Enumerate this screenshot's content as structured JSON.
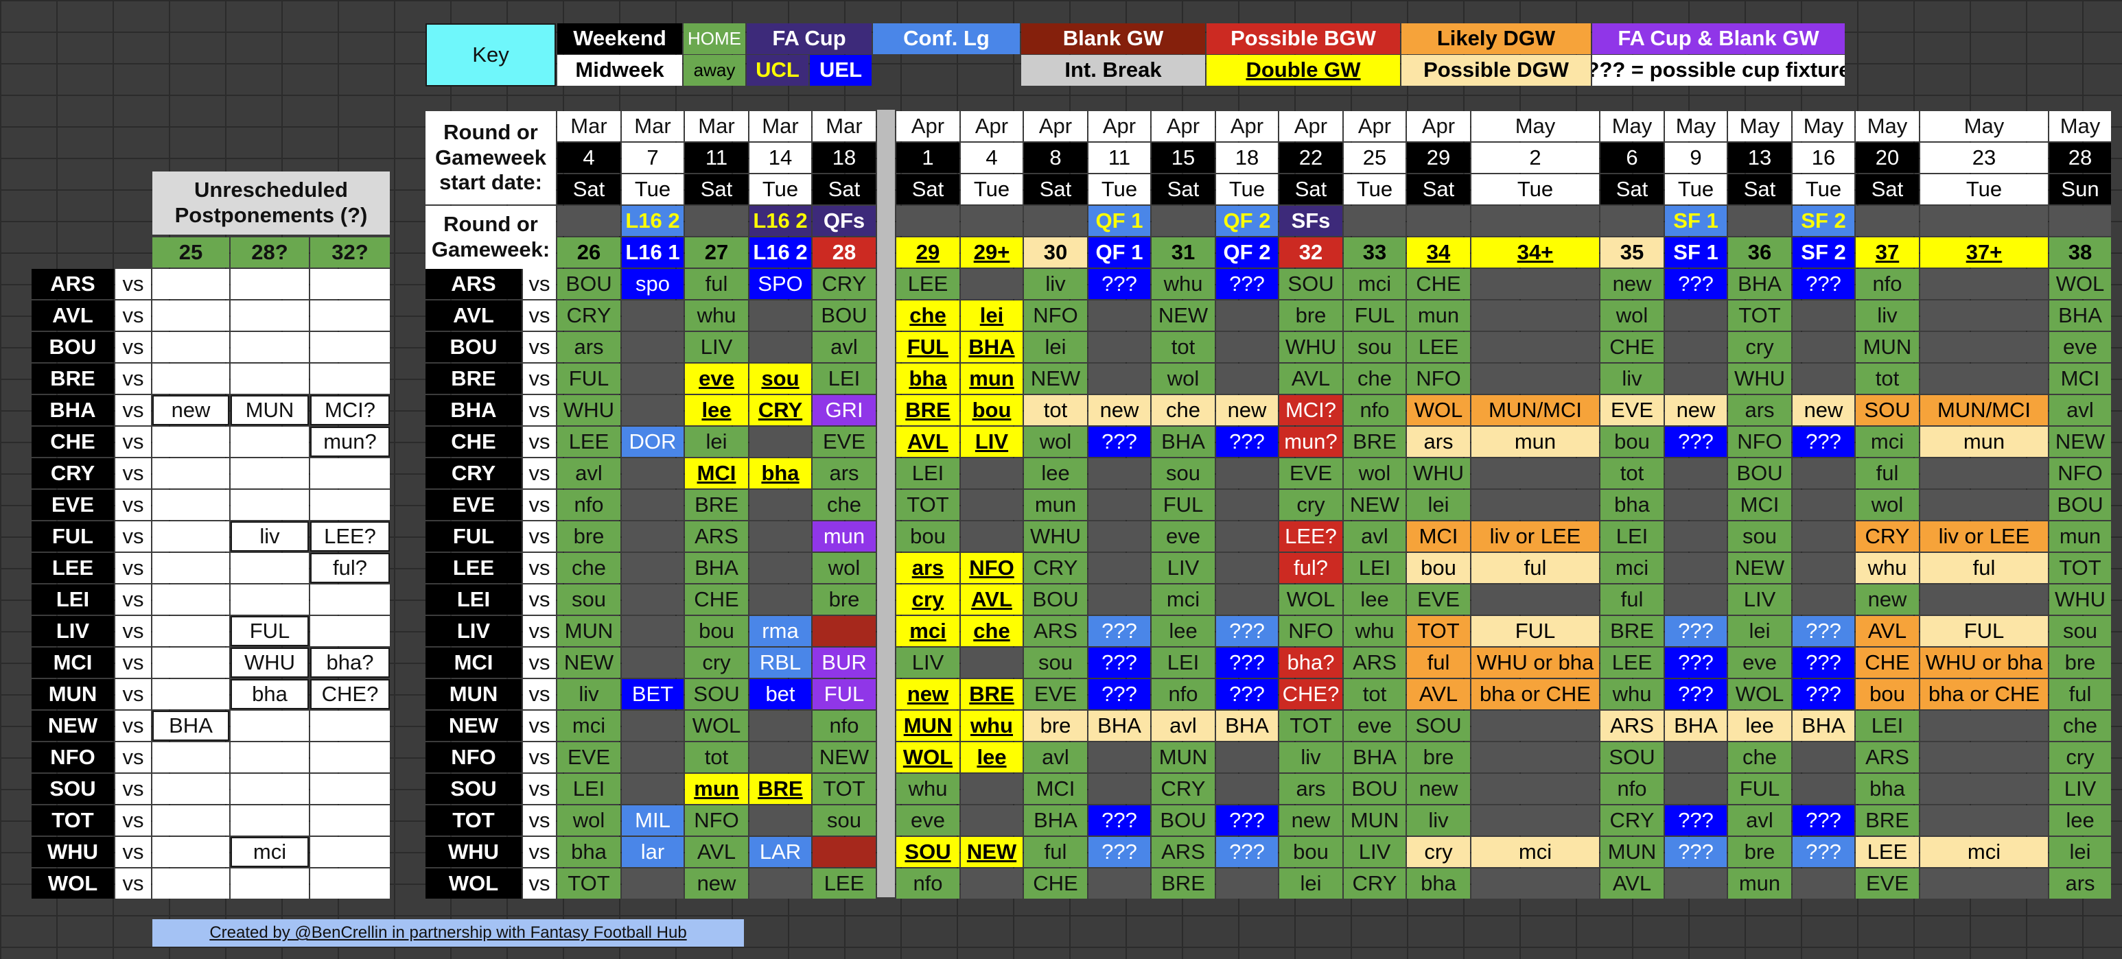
{
  "key": {
    "title": "Key",
    "items": [
      {
        "t": "Weekend",
        "bg": "#000000",
        "fg": "#ffffff",
        "b": 1
      },
      {
        "t": "HOME",
        "bg": "#6aa84f",
        "fg": "#ffffff",
        "b": 0
      },
      {
        "t": "FA Cup",
        "bg": "#3d2a7a",
        "fg": "#ffffff",
        "b": 1
      },
      {
        "t": "Conf. Lg",
        "bg": "#4a86e8",
        "fg": "#ffffff",
        "b": 1
      },
      {
        "t": "Blank GW",
        "bg": "#85200c",
        "fg": "#ffffff",
        "b": 1
      },
      {
        "t": "Possible BGW",
        "bg": "#cc2a22",
        "fg": "#ffffff",
        "b": 1
      },
      {
        "t": "Likely DGW",
        "bg": "#f6a33a",
        "fg": "#000000",
        "b": 1
      },
      {
        "t": "FA Cup & Blank GW",
        "bg": "#9036e8",
        "fg": "#ffffff",
        "b": 1
      },
      {
        "t": "Midweek",
        "bg": "#ffffff",
        "fg": "#000000",
        "b": 1
      },
      {
        "t": "away",
        "bg": "#6aa84f",
        "fg": "#000000",
        "b": 0
      },
      {
        "t": "UCL",
        "bg": "#3d2a7a",
        "fg": "#ffff00",
        "b": 1
      },
      {
        "t": "UEL",
        "bg": "#0000ff",
        "fg": "#ffffff",
        "b": 1
      },
      {
        "t": "Int. Break",
        "bg": "#cccccc",
        "fg": "#000000",
        "b": 1
      },
      {
        "t": "Double GW",
        "bg": "#ffff00",
        "fg": "#000000",
        "b": 1,
        "u": 1
      },
      {
        "t": "Possible DGW",
        "bg": "#fce5a6",
        "fg": "#000000",
        "b": 1
      },
      {
        "t": "??? = possible cup fixture",
        "bg": "#ffffff",
        "fg": "#000000",
        "b": 1
      }
    ]
  },
  "labels": {
    "round_start": "Round or Gameweek start date:",
    "round_gw": "Round or Gameweek:",
    "unresched": "Unrescheduled Postponements (?)",
    "vs": "vs",
    "credit": "Created by @BenCrellin in partnership with Fantasy Football Hub"
  },
  "postponement_cols": [
    "25",
    "28?",
    "32?"
  ],
  "postponements": [
    [
      "",
      "",
      ""
    ],
    [
      "",
      "",
      ""
    ],
    [
      "",
      "",
      ""
    ],
    [
      "",
      "",
      ""
    ],
    [
      "new",
      "MUN",
      "MCI?"
    ],
    [
      "",
      "",
      "mun?"
    ],
    [
      "",
      "",
      ""
    ],
    [
      "",
      "",
      ""
    ],
    [
      "",
      "liv",
      "LEE?"
    ],
    [
      "",
      "",
      "ful?"
    ],
    [
      "",
      "",
      ""
    ],
    [
      "",
      "FUL",
      ""
    ],
    [
      "",
      "WHU",
      "bha?"
    ],
    [
      "",
      "bha",
      "CHE?"
    ],
    [
      "BHA",
      "",
      ""
    ],
    [
      "",
      "",
      ""
    ],
    [
      "",
      "",
      ""
    ],
    [
      "",
      "",
      ""
    ],
    [
      "",
      "mci",
      ""
    ],
    [
      "",
      "",
      ""
    ]
  ],
  "teams": [
    "ARS",
    "AVL",
    "BOU",
    "BRE",
    "BHA",
    "CHE",
    "CRY",
    "EVE",
    "FUL",
    "LEE",
    "LEI",
    "LIV",
    "MCI",
    "MUN",
    "NEW",
    "NFO",
    "SOU",
    "TOT",
    "WHU",
    "WOL"
  ],
  "columns": [
    {
      "month": "Mar",
      "day": "4",
      "dow": "Sat",
      "rnd": "",
      "gw": "26",
      "mid": 0,
      "rb": "",
      "gb": "#6aa84f"
    },
    {
      "month": "Mar",
      "day": "7",
      "dow": "Tue",
      "rnd": "L16 2",
      "gw": "L16 1",
      "mid": 1,
      "rb": "#4a86e8",
      "gb": "#0000ff",
      "rf": "#ffff00",
      "gf": "#ffffff"
    },
    {
      "month": "Mar",
      "day": "11",
      "dow": "Sat",
      "rnd": "",
      "gw": "27",
      "mid": 0,
      "rb": "",
      "gb": "#6aa84f"
    },
    {
      "month": "Mar",
      "day": "14",
      "dow": "Tue",
      "rnd": "L16 2",
      "gw": "L16 2",
      "mid": 1,
      "rb": "#3d2a7a",
      "gb": "#0000ff",
      "rf": "#ffff00",
      "gf": "#ffffff"
    },
    {
      "month": "Mar",
      "day": "18",
      "dow": "Sat",
      "rnd": "QFs",
      "gw": "28",
      "mid": 0,
      "rb": "#3d2a7a",
      "gb": "#cc2a22",
      "rf": "#ffffff",
      "gf": "#ffffff"
    },
    {
      "month": "Apr",
      "day": "1",
      "dow": "Sat",
      "rnd": "",
      "gw": "29",
      "mid": 0,
      "rb": "",
      "gb": "#ffff00",
      "gu": 1
    },
    {
      "month": "Apr",
      "day": "4",
      "dow": "Tue",
      "rnd": "",
      "gw": "29+",
      "mid": 1,
      "rb": "",
      "gb": "#ffff00",
      "gu": 1
    },
    {
      "month": "Apr",
      "day": "8",
      "dow": "Sat",
      "rnd": "",
      "gw": "30",
      "mid": 0,
      "rb": "",
      "gb": "#fce5a6"
    },
    {
      "month": "Apr",
      "day": "11",
      "dow": "Tue",
      "rnd": "QF 1",
      "gw": "QF 1",
      "mid": 1,
      "rb": "#4a86e8",
      "gb": "#0000ff",
      "rf": "#ffff00",
      "gf": "#ffffff"
    },
    {
      "month": "Apr",
      "day": "15",
      "dow": "Sat",
      "rnd": "",
      "gw": "31",
      "mid": 0,
      "rb": "",
      "gb": "#6aa84f"
    },
    {
      "month": "Apr",
      "day": "18",
      "dow": "Tue",
      "rnd": "QF 2",
      "gw": "QF 2",
      "mid": 1,
      "rb": "#4a86e8",
      "gb": "#0000ff",
      "rf": "#ffff00",
      "gf": "#ffffff"
    },
    {
      "month": "Apr",
      "day": "22",
      "dow": "Sat",
      "rnd": "SFs",
      "gw": "32",
      "mid": 0,
      "rb": "#3d2a7a",
      "gb": "#cc2a22",
      "rf": "#ffffff",
      "gf": "#ffffff"
    },
    {
      "month": "Apr",
      "day": "25",
      "dow": "Tue",
      "rnd": "",
      "gw": "33",
      "mid": 1,
      "rb": "",
      "gb": "#6aa84f"
    },
    {
      "month": "Apr",
      "day": "29",
      "dow": "Sat",
      "rnd": "",
      "gw": "34",
      "mid": 0,
      "rb": "",
      "gb": "#ffff00",
      "gu": 1
    },
    {
      "month": "May",
      "day": "2",
      "dow": "Tue",
      "rnd": "",
      "gw": "34+",
      "mid": 1,
      "rb": "",
      "gb": "#ffff00",
      "gu": 1
    },
    {
      "month": "May",
      "day": "6",
      "dow": "Sat",
      "rnd": "",
      "gw": "35",
      "mid": 0,
      "rb": "",
      "gb": "#fce5a6"
    },
    {
      "month": "May",
      "day": "9",
      "dow": "Tue",
      "rnd": "SF 1",
      "gw": "SF 1",
      "mid": 1,
      "rb": "#4a86e8",
      "gb": "#0000ff",
      "rf": "#ffff00",
      "gf": "#ffffff"
    },
    {
      "month": "May",
      "day": "13",
      "dow": "Sat",
      "rnd": "",
      "gw": "36",
      "mid": 0,
      "rb": "",
      "gb": "#6aa84f"
    },
    {
      "month": "May",
      "day": "16",
      "dow": "Tue",
      "rnd": "SF 2",
      "gw": "SF 2",
      "mid": 1,
      "rb": "#4a86e8",
      "gb": "#0000ff",
      "rf": "#ffff00",
      "gf": "#ffffff"
    },
    {
      "month": "May",
      "day": "20",
      "dow": "Sat",
      "rnd": "",
      "gw": "37",
      "mid": 0,
      "rb": "",
      "gb": "#ffff00",
      "gu": 1
    },
    {
      "month": "May",
      "day": "23",
      "dow": "Tue",
      "rnd": "",
      "gw": "37+",
      "mid": 1,
      "rb": "",
      "gb": "#ffff00",
      "gu": 1
    },
    {
      "month": "May",
      "day": "28",
      "dow": "Sun",
      "rnd": "",
      "gw": "38",
      "mid": 0,
      "rb": "",
      "gb": "#6aa84f"
    }
  ],
  "fixtures": [
    [
      "BOU",
      "spo:E",
      "ful",
      "SPO:E",
      "CRY",
      "LEE",
      "",
      "liv",
      "???:E",
      "whu",
      "???:E",
      "SOU",
      "mci",
      "CHE",
      "",
      "new",
      "???:E",
      "BHA",
      "???:E",
      "nfo",
      "",
      "WOL"
    ],
    [
      "CRY",
      "",
      "whu",
      "",
      "BOU",
      "che:D",
      "lei:D",
      "NFO",
      "",
      "NEW",
      "",
      "bre",
      "FUL",
      "mun",
      "",
      "wol",
      "",
      "TOT",
      "",
      "liv",
      "",
      "BHA"
    ],
    [
      "ars",
      "",
      "LIV",
      "",
      "avl",
      "FUL:D",
      "BHA:D",
      "lei",
      "",
      "tot",
      "",
      "WHU",
      "sou",
      "LEE",
      "",
      "CHE",
      "",
      "cry",
      "",
      "MUN",
      "",
      "eve"
    ],
    [
      "FUL",
      "",
      "eve:D",
      "sou:D",
      "LEI",
      "bha:D",
      "mun:D",
      "NEW",
      "",
      "wol",
      "",
      "AVL",
      "che",
      "NFO",
      "",
      "liv",
      "",
      "WHU",
      "",
      "tot",
      "",
      "MCI"
    ],
    [
      "WHU",
      "",
      "lee:D",
      "CRY:D",
      "GRI:F",
      "BRE:D",
      "bou:D",
      "tot:P",
      "new:P",
      "che:P",
      "new:P",
      "MCI?:R",
      "nfo",
      "WOL:L",
      "MUN/MCI:L",
      "EVE:P",
      "new:P",
      "ars",
      "new:P",
      "SOU:L",
      "MUN/MCI:L",
      "avl"
    ],
    [
      "LEE",
      "DOR:C",
      "lei",
      "",
      "EVE",
      "AVL:D",
      "LIV:D",
      "wol",
      "???:E",
      "BHA",
      "???:E",
      "mun?:R",
      "BRE",
      "ars:P",
      "mun:P",
      "bou",
      "???:E",
      "NFO",
      "???:E",
      "mci",
      "mun:P",
      "NEW"
    ],
    [
      "avl",
      "",
      "MCI:D",
      "bha:D",
      "ars",
      "LEI",
      "",
      "lee",
      "",
      "sou",
      "",
      "EVE",
      "wol",
      "WHU",
      "",
      "tot",
      "",
      "BOU",
      "",
      "ful",
      "",
      "NFO"
    ],
    [
      "nfo",
      "",
      "BRE",
      "",
      "che",
      "TOT",
      "",
      "mun",
      "",
      "FUL",
      "",
      "cry",
      "NEW",
      "lei",
      "",
      "bha",
      "",
      "MCI",
      "",
      "wol",
      "",
      "BOU"
    ],
    [
      "bre",
      "",
      "ARS",
      "",
      "mun:F",
      "bou",
      "",
      "WHU",
      "",
      "eve",
      "",
      "LEE?:R",
      "avl",
      "MCI:L",
      "liv or LEE:L",
      "LEI",
      "",
      "sou",
      "",
      "CRY:L",
      "liv or LEE:L",
      "mun"
    ],
    [
      "che",
      "",
      "BHA",
      "",
      "wol",
      "ars:D",
      "NFO:D",
      "CRY",
      "",
      "LIV",
      "",
      "ful?:R",
      "LEI",
      "bou:P",
      "ful:P",
      "mci",
      "",
      "NEW",
      "",
      "whu:P",
      "ful:P",
      "TOT"
    ],
    [
      "sou",
      "",
      "CHE",
      "",
      "bre",
      "cry:D",
      "AVL:D",
      "BOU",
      "",
      "mci",
      "",
      "WOL",
      "lee",
      "EVE",
      "",
      "ful",
      "",
      "LIV",
      "",
      "new",
      "",
      "WHU"
    ],
    [
      "MUN",
      "",
      "bou",
      "rma:C",
      "X:K",
      "mci:D",
      "che:D",
      "ARS",
      "???:C",
      "lee",
      "???:C",
      "NFO",
      "whu",
      "TOT:L",
      "FUL:P",
      "BRE",
      "???:C",
      "lei",
      "???:C",
      "AVL:L",
      "FUL:P",
      "sou"
    ],
    [
      "NEW",
      "",
      "cry",
      "RBL:C",
      "BUR:F",
      "LIV",
      "",
      "sou",
      "???:E",
      "LEI",
      "???:E",
      "bha?:R",
      "ARS",
      "ful:L",
      "WHU or bha:L",
      "LEE",
      "???:E",
      "eve",
      "???:E",
      "CHE:L",
      "WHU or bha:L",
      "bre"
    ],
    [
      "liv",
      "BET:E",
      "SOU",
      "bet:E",
      "FUL:F",
      "new:D",
      "BRE:D",
      "EVE",
      "???:E",
      "nfo",
      "???:E",
      "CHE?:R",
      "tot",
      "AVL:L",
      "bha or CHE:L",
      "whu",
      "???:E",
      "WOL",
      "???:E",
      "bou:L",
      "bha or CHE:L",
      "ful"
    ],
    [
      "mci",
      "",
      "WOL",
      "",
      "nfo",
      "MUN:D",
      "whu:D",
      "bre:P",
      "BHA:P",
      "avl:P",
      "BHA:P",
      "TOT",
      "eve",
      "SOU",
      "",
      "ARS:P",
      "BHA:P",
      "lee:P",
      "BHA:P",
      "LEI",
      "",
      "che"
    ],
    [
      "EVE",
      "",
      "tot",
      "",
      "NEW",
      "WOL:D",
      "lee:D",
      "avl",
      "",
      "MUN",
      "",
      "liv",
      "BHA",
      "bre",
      "",
      "SOU",
      "",
      "che",
      "",
      "ARS",
      "",
      "cry"
    ],
    [
      "LEI",
      "",
      "mun:D",
      "BRE:D",
      "TOT",
      "whu",
      "",
      "MCI",
      "",
      "CRY",
      "",
      "ars",
      "BOU",
      "new",
      "",
      "nfo",
      "",
      "FUL",
      "",
      "bha",
      "",
      "LIV"
    ],
    [
      "wol",
      "MIL:C",
      "NFO",
      "",
      "sou",
      "eve",
      "",
      "BHA",
      "???:E",
      "BOU",
      "???:E",
      "new",
      "MUN",
      "liv",
      "",
      "CRY",
      "???:E",
      "avl",
      "???:E",
      "BRE",
      "",
      "lee"
    ],
    [
      "bha",
      "lar:C",
      "AVL",
      "LAR:C",
      "X:K",
      "SOU:D",
      "NEW:D",
      "ful",
      "???:C",
      "ARS",
      "???:C",
      "bou",
      "LIV",
      "cry:P",
      "mci:P",
      "MUN",
      "???:C",
      "bre",
      "???:C",
      "LEE:P",
      "mci:P",
      "lei"
    ],
    [
      "TOT",
      "",
      "new",
      "",
      "LEE",
      "nfo",
      "",
      "CHE",
      "",
      "BRE",
      "",
      "lei",
      "CRY",
      "bha",
      "",
      "AVL",
      "",
      "mun",
      "",
      "EVE",
      "",
      "ars"
    ]
  ],
  "styles": {
    "D": {
      "bg": "#ffff00",
      "fg": "#000000",
      "b": 1,
      "u": 1
    },
    "P": {
      "bg": "#fce5a6",
      "fg": "#000000"
    },
    "L": {
      "bg": "#f6a33a",
      "fg": "#000000"
    },
    "R": {
      "bg": "#cc2a22",
      "fg": "#ffffff"
    },
    "E": {
      "bg": "#0000ff",
      "fg": "#ffffff"
    },
    "C": {
      "bg": "#4a86e8",
      "fg": "#ffffff"
    },
    "F": {
      "bg": "#9036e8",
      "fg": "#ffffff"
    },
    "K": {
      "bg": "#a6281c",
      "fg": "#a6281c"
    }
  },
  "colors": {
    "home_green": "#6aa84f",
    "empty_cell": "#545454",
    "team_bg": "#000000",
    "header_bg": "#ffffff",
    "key_title_bg": "#6ff7fb",
    "divider": "#bcbcbc",
    "credit_bg": "#a4c2f4"
  }
}
